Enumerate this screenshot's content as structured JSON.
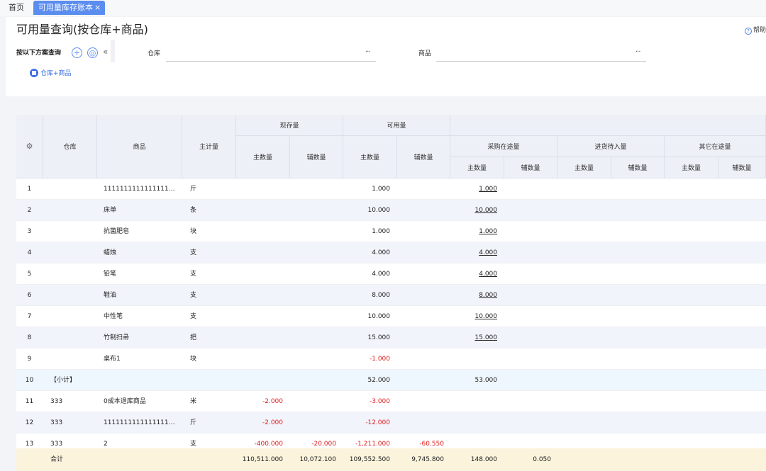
{
  "tabs": {
    "home": "首页",
    "active": "可用量库存账本",
    "close": "×"
  },
  "header": {
    "title": "可用量查询(按仓库+商品)",
    "help": "帮助",
    "help_icon": "?",
    "query_label": "按以下方案查询",
    "add_symbol": "+",
    "target_symbol": "◎",
    "collapse_symbol": "«",
    "warehouse_label": "仓库",
    "product_label": "商品",
    "more": "···",
    "scheme": "仓库+商品"
  },
  "columns": {
    "warehouse": "仓库",
    "product": "商品",
    "main_unit": "主计量",
    "current_stock": "现存量",
    "available": "可用量",
    "purchase_transit": "采购在途量",
    "incoming_pending": "进货待入量",
    "other_transit": "其它在途量",
    "main_qty": "主数量",
    "aux_qty": "辅数量"
  },
  "rows": [
    {
      "no": "1",
      "warehouse": "",
      "product": "111111111111111111111...",
      "unit": "斤",
      "stock_main": "",
      "stock_aux": "",
      "avail_main": "1.000",
      "avail_aux": "",
      "po_main": "1.000"
    },
    {
      "no": "2",
      "warehouse": "",
      "product": "床单",
      "unit": "条",
      "stock_main": "",
      "stock_aux": "",
      "avail_main": "10.000",
      "avail_aux": "",
      "po_main": "10.000"
    },
    {
      "no": "3",
      "warehouse": "",
      "product": "抗菌肥皂",
      "unit": "块",
      "stock_main": "",
      "stock_aux": "",
      "avail_main": "1.000",
      "avail_aux": "",
      "po_main": "1.000"
    },
    {
      "no": "4",
      "warehouse": "",
      "product": "蜡烛",
      "unit": "支",
      "stock_main": "",
      "stock_aux": "",
      "avail_main": "4.000",
      "avail_aux": "",
      "po_main": "4.000"
    },
    {
      "no": "5",
      "warehouse": "",
      "product": "铅笔",
      "unit": "支",
      "stock_main": "",
      "stock_aux": "",
      "avail_main": "4.000",
      "avail_aux": "",
      "po_main": "4.000"
    },
    {
      "no": "6",
      "warehouse": "",
      "product": "鞋油",
      "unit": "支",
      "stock_main": "",
      "stock_aux": "",
      "avail_main": "8.000",
      "avail_aux": "",
      "po_main": "8.000"
    },
    {
      "no": "7",
      "warehouse": "",
      "product": "中性笔",
      "unit": "支",
      "stock_main": "",
      "stock_aux": "",
      "avail_main": "10.000",
      "avail_aux": "",
      "po_main": "10.000"
    },
    {
      "no": "8",
      "warehouse": "",
      "product": "竹制扫帚",
      "unit": "把",
      "stock_main": "",
      "stock_aux": "",
      "avail_main": "15.000",
      "avail_aux": "",
      "po_main": "15.000"
    },
    {
      "no": "9",
      "warehouse": "",
      "product": "桌布1",
      "unit": "块",
      "stock_main": "",
      "stock_aux": "",
      "avail_main": "-1.000",
      "avail_aux": "",
      "po_main": ""
    },
    {
      "no": "10",
      "warehouse": "【小计】",
      "product": "",
      "unit": "",
      "stock_main": "",
      "stock_aux": "",
      "avail_main": "52.000",
      "avail_aux": "",
      "po_main": "53.000"
    },
    {
      "no": "11",
      "warehouse": "333",
      "product": "0成本退库商品",
      "unit": "米",
      "stock_main": "-2.000",
      "stock_aux": "",
      "avail_main": "-3.000",
      "avail_aux": "",
      "po_main": ""
    },
    {
      "no": "12",
      "warehouse": "333",
      "product": "111111111111111111111...",
      "unit": "斤",
      "stock_main": "-2.000",
      "stock_aux": "",
      "avail_main": "-12.000",
      "avail_aux": "",
      "po_main": ""
    },
    {
      "no": "13",
      "warehouse": "333",
      "product": "2",
      "unit": "支",
      "stock_main": "-400.000",
      "stock_aux": "-20.000",
      "avail_main": "-1,211.000",
      "avail_aux": "-60.550",
      "po_main": ""
    }
  ],
  "total": {
    "label": "合计",
    "stock_main": "110,511.000",
    "stock_aux": "10,072.100",
    "avail_main": "109,552.500",
    "avail_aux": "9,745.800",
    "po_main": "148.000",
    "po_aux": "0.050"
  },
  "colors": {
    "accent": "#5b8def",
    "negative": "#e02020",
    "subtotal_bg": "#eef7fd",
    "total_bg": "#fbf3dc"
  }
}
